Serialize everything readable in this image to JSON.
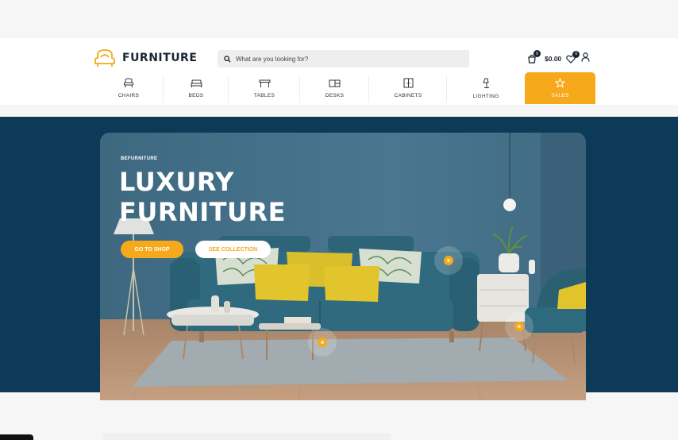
{
  "header": {
    "logo_text": "FURNITURE",
    "search_placeholder": "What are you looking for?",
    "cart_count": "0",
    "cart_total": "$0.00",
    "wishlist_count": "0"
  },
  "nav": {
    "items": [
      {
        "label": "CHAIRS",
        "icon": "chair-icon"
      },
      {
        "label": "BEDS",
        "icon": "bed-icon"
      },
      {
        "label": "TABLES",
        "icon": "table-icon"
      },
      {
        "label": "DESKS",
        "icon": "desk-icon"
      },
      {
        "label": "CABINETS",
        "icon": "cabinet-icon"
      },
      {
        "label": "LIGHTING",
        "icon": "lamp-icon"
      },
      {
        "label": "SALES",
        "icon": "star-icon",
        "active": true
      }
    ]
  },
  "hero": {
    "eyebrow": "BEFURNITURE",
    "headline_line1": "LUXURY",
    "headline_line2": "FURNITURE",
    "primary_button": "GO TO SHOP",
    "secondary_button": "SEE COLLECTION"
  },
  "colors": {
    "accent": "#f6a91b",
    "hero_bg": "#0d3a57",
    "text_dark": "#1b2433",
    "wall": "#456f85"
  }
}
